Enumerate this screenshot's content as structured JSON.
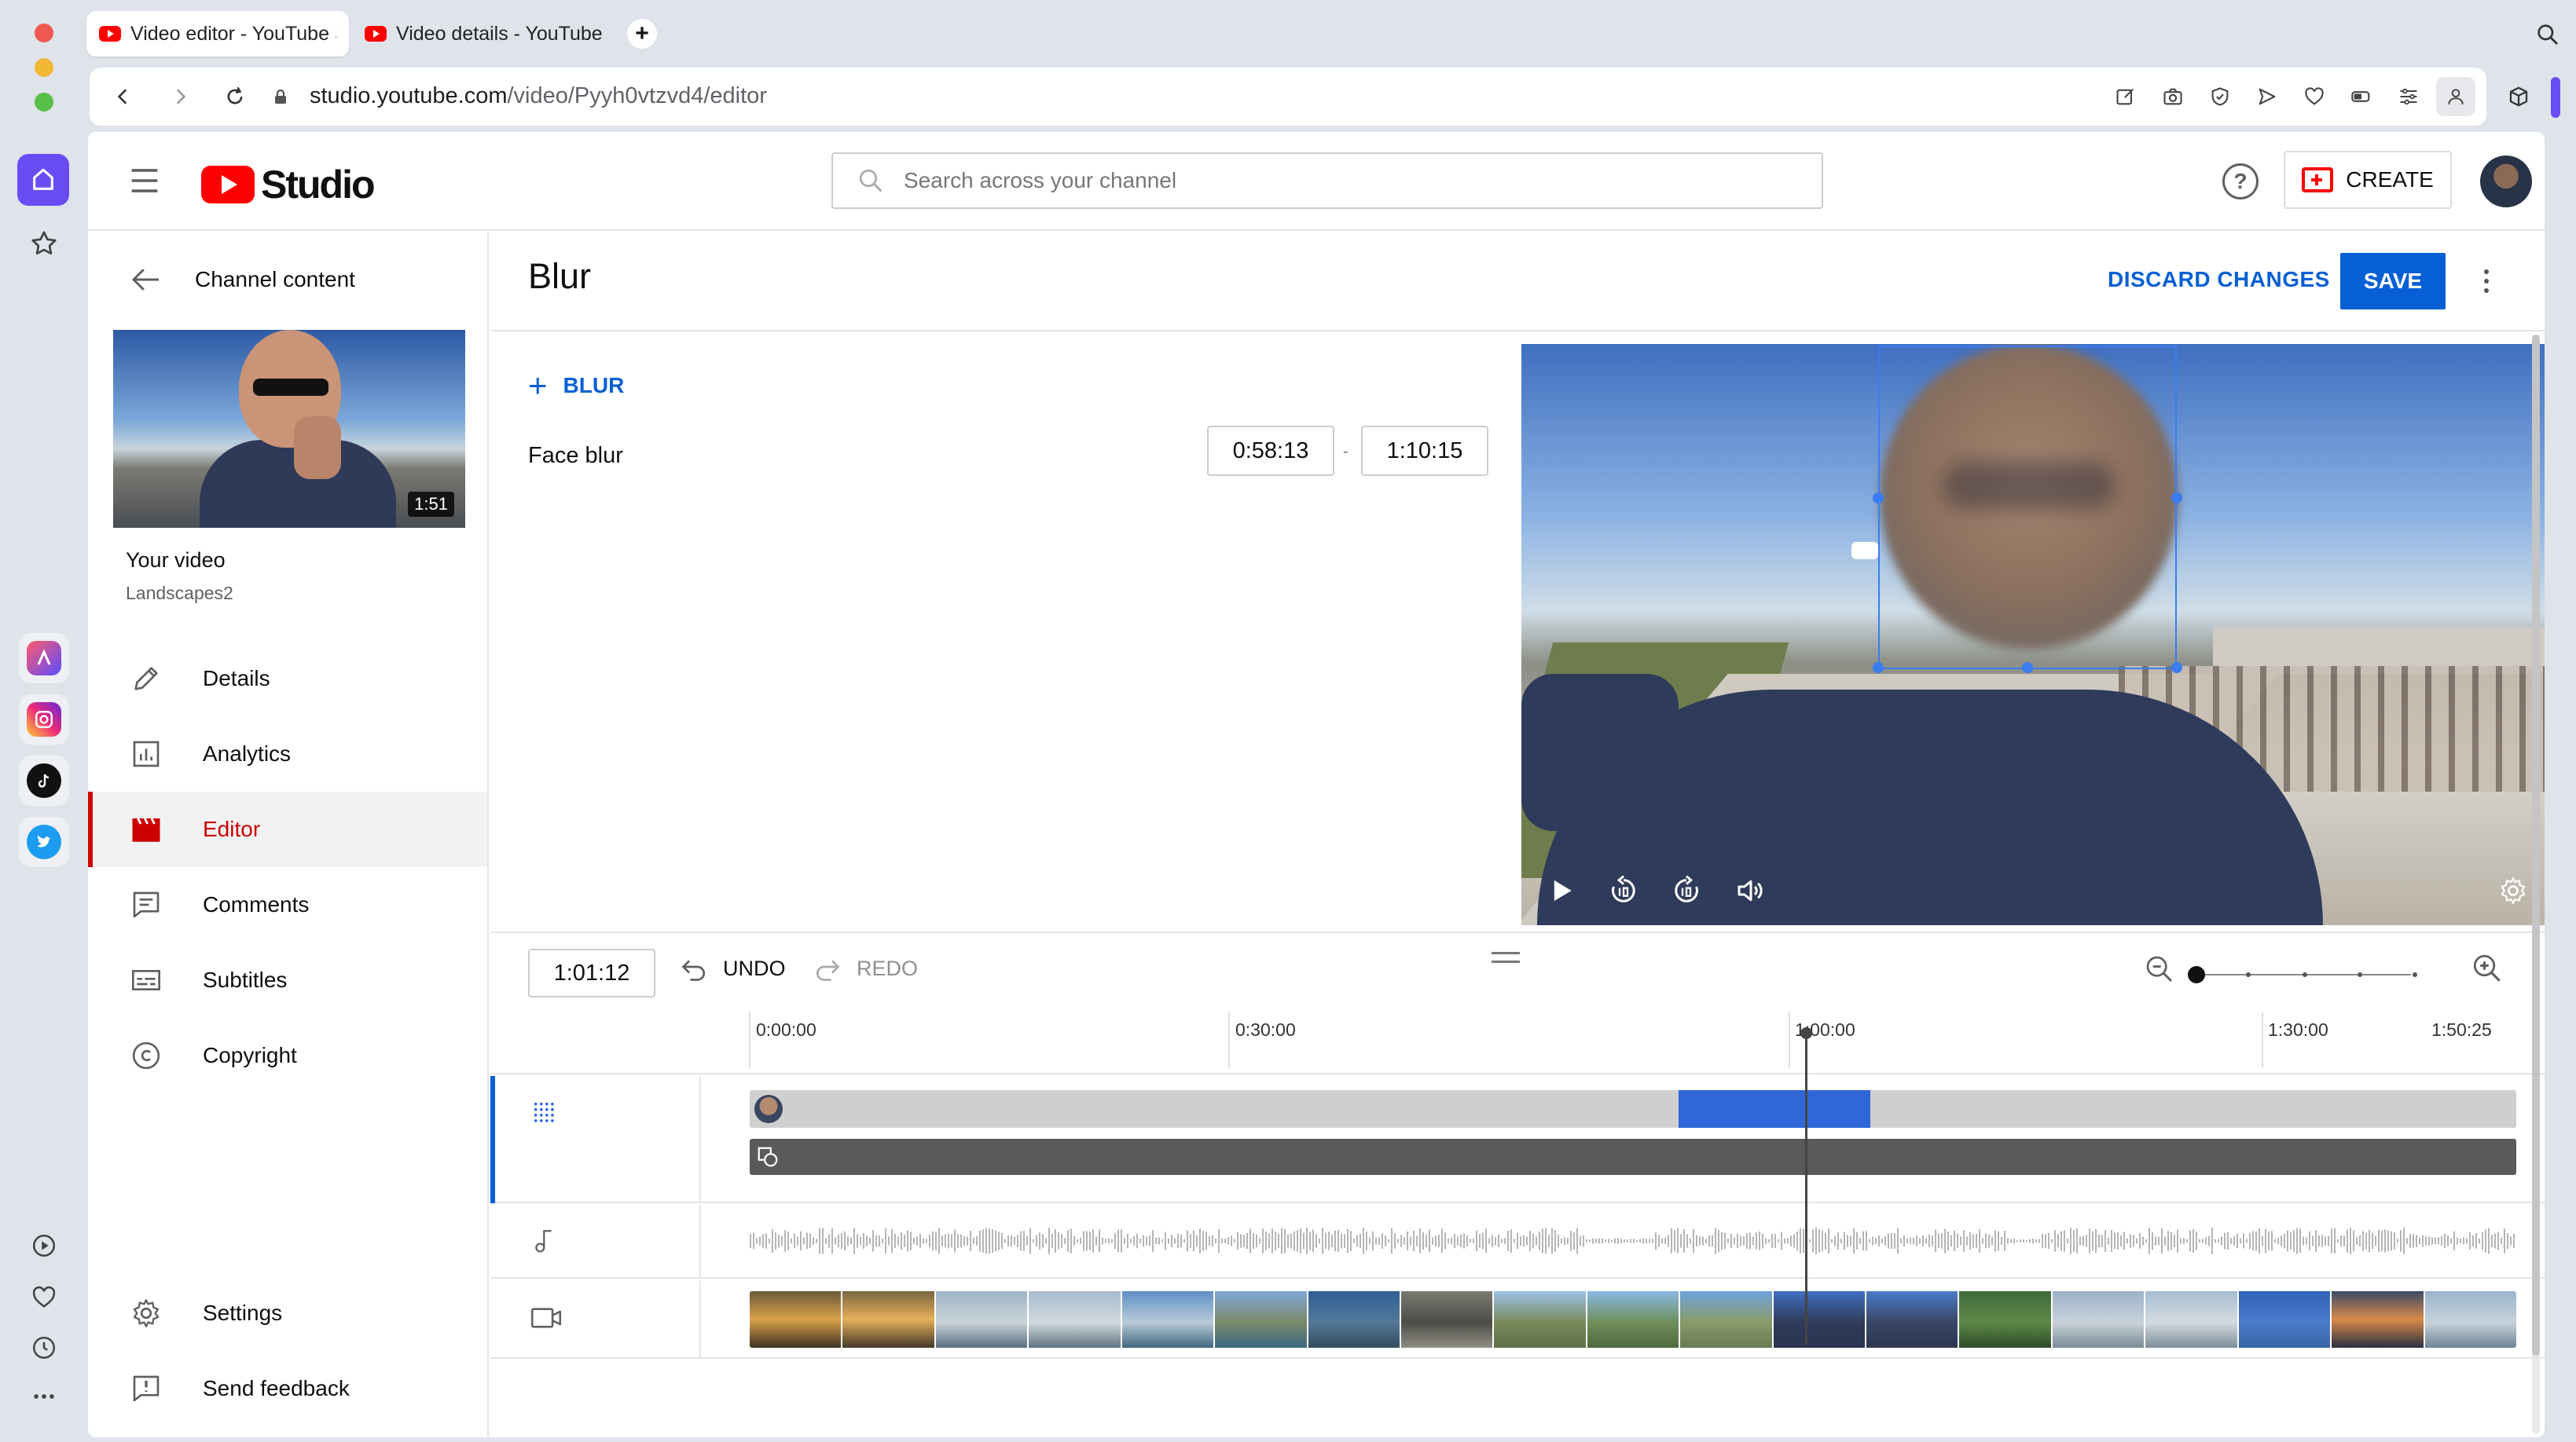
{
  "browser": {
    "tabs": [
      {
        "title": "Video editor - YouTube Studio",
        "active": true
      },
      {
        "title": "Video details - YouTube Studio",
        "active": false
      }
    ],
    "new_tab_label": "+",
    "url_host": "studio.youtube.com",
    "url_path": "/video/Pyyh0vtzvd4/editor"
  },
  "studio": {
    "logo_text": "Studio",
    "search_placeholder": "Search across your channel",
    "help_label": "?",
    "create_label": "CREATE"
  },
  "leftnav": {
    "back_label": "Channel content",
    "thumbnail_duration": "1:51",
    "your_video_label": "Your video",
    "video_name": "Landscapes2",
    "items": [
      {
        "label": "Details",
        "icon": "pencil-icon",
        "active": false
      },
      {
        "label": "Analytics",
        "icon": "analytics-icon",
        "active": false
      },
      {
        "label": "Editor",
        "icon": "clapper-icon",
        "active": true
      },
      {
        "label": "Comments",
        "icon": "comments-icon",
        "active": false
      },
      {
        "label": "Subtitles",
        "icon": "subtitles-icon",
        "active": false
      },
      {
        "label": "Copyright",
        "icon": "copyright-icon",
        "active": false
      }
    ],
    "bottom_items": [
      {
        "label": "Settings",
        "icon": "gear-icon"
      },
      {
        "label": "Send feedback",
        "icon": "feedback-icon"
      }
    ]
  },
  "editor": {
    "title": "Blur",
    "discard_label": "DISCARD CHANGES",
    "save_label": "SAVE",
    "add_blur_label": "BLUR",
    "blur_items": [
      {
        "label": "Face blur",
        "start": "0:58:13",
        "end": "1:10:15"
      }
    ],
    "range_separator": "-",
    "current_time": "1:01:12",
    "undo_label": "UNDO",
    "redo_label": "REDO",
    "ruler_ticks": [
      "0:00:00",
      "0:30:00",
      "1:00:00",
      "1:30:00",
      "1:50:25"
    ]
  },
  "colors": {
    "accent_blue": "#065fd4",
    "active_red": "#cc0000",
    "blur_segment": "#2f67d8",
    "youtube_red": "#ff0000"
  }
}
